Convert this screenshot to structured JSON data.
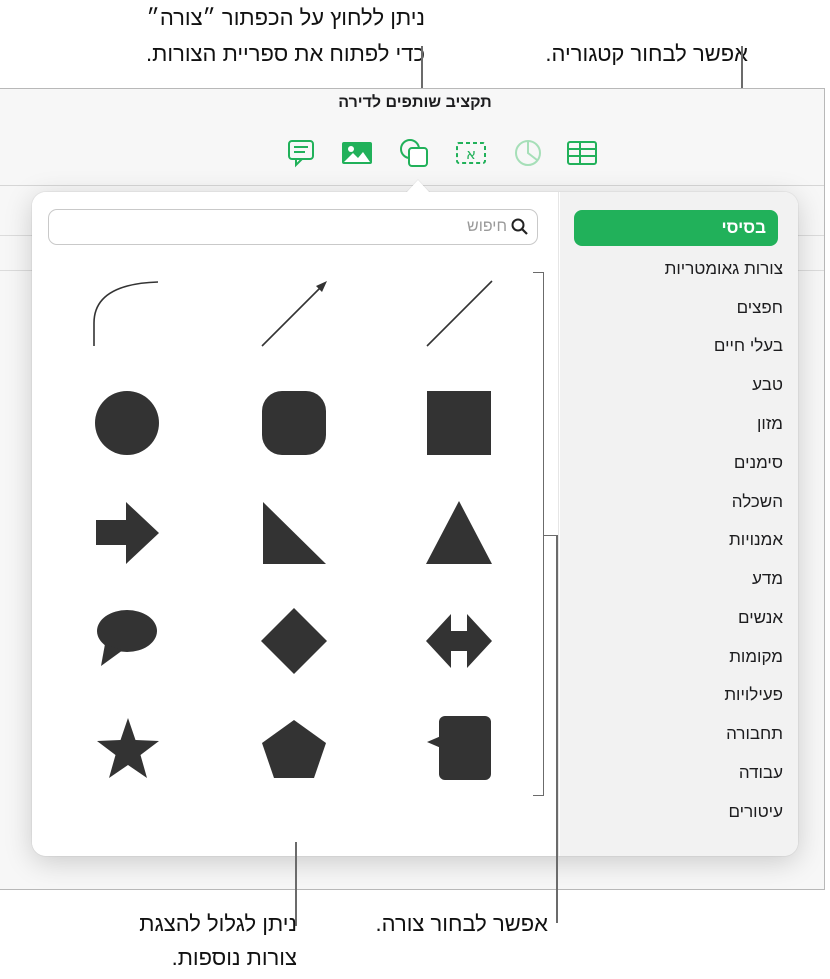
{
  "callouts": {
    "shape_button_line1": "ניתן ללחוץ על הכפתור ״צורה״",
    "shape_button_line2": "כדי לפתוח את ספריית הצורות.",
    "choose_category": "אפשר לבחור קטגוריה.",
    "scroll_line1": "ניתן לגלול להצגת",
    "scroll_line2": "צורות נוספות.",
    "choose_shape": "אפשר לבחור צורה."
  },
  "toolbar": {
    "document_title": "תקציב שותפים לדירה",
    "icons": [
      "comment-icon",
      "media-icon",
      "shape-icon",
      "text-icon",
      "chart-icon",
      "table-icon"
    ],
    "accent_color": "#21b15a"
  },
  "search": {
    "placeholder": "חיפוש"
  },
  "categories": {
    "selected": "בסיסי",
    "items": [
      "צורות גאומטריות",
      "חפצים",
      "בעלי חיים",
      "טבע",
      "מזון",
      "סימנים",
      "השכלה",
      "אמנויות",
      "מדע",
      "אנשים",
      "מקומות",
      "פעילויות",
      "תחבורה",
      "עבודה",
      "עיטורים"
    ]
  },
  "shapes": [
    "line",
    "arrow-line",
    "curve",
    "square",
    "rounded-square",
    "circle",
    "triangle",
    "right-triangle",
    "arrow",
    "double-arrow",
    "diamond",
    "speech-bubble",
    "callout-square",
    "pentagon",
    "star"
  ]
}
